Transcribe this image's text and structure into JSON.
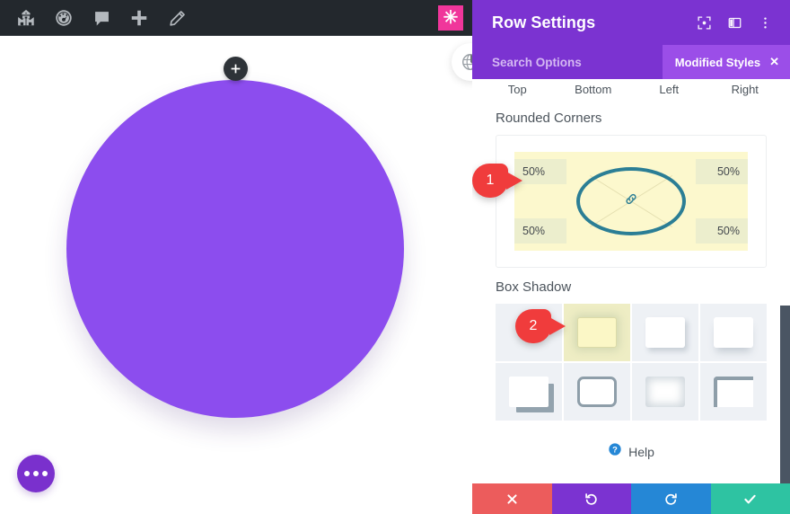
{
  "admin_bar": {
    "items": [
      {
        "name": "site-home-icon",
        "label": "My Sites"
      },
      {
        "name": "dashboard-icon",
        "label": "Dashboard"
      },
      {
        "name": "comments-icon",
        "label": "Comments"
      },
      {
        "name": "new-content-icon",
        "label": "New"
      },
      {
        "name": "edit-page-icon",
        "label": "Edit Page"
      }
    ],
    "badge": {
      "name": "divi-logo-icon",
      "glyph": "✳",
      "color": "#f0369b"
    },
    "background": "#23282d"
  },
  "canvas": {
    "module": {
      "shape": "circle",
      "color": "#8c4dee",
      "add_button_label": "+"
    },
    "globe_chip": {
      "name": "globe-icon"
    },
    "fab": {
      "name": "page-settings-fab",
      "dots": 3,
      "color": "#7a30cd"
    }
  },
  "panel": {
    "title": "Row Settings",
    "accent": "#7b33d1",
    "header_icons": [
      {
        "name": "expand-view-icon",
        "label": "Expand"
      },
      {
        "name": "panel-layout-icon",
        "label": "Layout"
      },
      {
        "name": "more-options-icon",
        "label": "More"
      }
    ],
    "search": {
      "placeholder": "Search Options",
      "value": ""
    },
    "modified_styles": {
      "label": "Modified Styles",
      "close_glyph": "✕",
      "color": "#9b4ee8"
    },
    "side_labels": [
      "Top",
      "Bottom",
      "Left",
      "Right"
    ],
    "rounded_corners": {
      "title": "Rounded Corners",
      "top_left": "50%",
      "top_right": "50%",
      "bottom_left": "50%",
      "bottom_right": "50%",
      "link_icon": "link-icon",
      "ring_color": "#2b7e95",
      "highlight_color": "#fcf8cd"
    },
    "box_shadow": {
      "title": "Box Shadow",
      "selected_index": 1,
      "presets": [
        {
          "name": "shadow-preset-none",
          "style": "s-none"
        },
        {
          "name": "shadow-preset-soft-glow",
          "style": "s-glow"
        },
        {
          "name": "shadow-preset-drop-right",
          "style": "s-soft"
        },
        {
          "name": "shadow-preset-drop-bottom",
          "style": "s-wide"
        },
        {
          "name": "shadow-preset-hard-offset",
          "style": "s-hard"
        },
        {
          "name": "shadow-preset-outline",
          "style": "s-border"
        },
        {
          "name": "shadow-preset-inset",
          "style": "s-inset"
        },
        {
          "name": "shadow-preset-corner-bracket",
          "style": "s-corner"
        }
      ]
    },
    "help": {
      "label": "Help",
      "icon": "help-circle-icon"
    },
    "actions": [
      {
        "name": "discard-button",
        "glyph": "✕",
        "color": "#ec5c5c"
      },
      {
        "name": "undo-button",
        "glyph": "↺",
        "color": "#7b33d1"
      },
      {
        "name": "redo-button",
        "glyph": "↻",
        "color": "#2587d6"
      },
      {
        "name": "save-button",
        "glyph": "✓",
        "color": "#2ec3a2"
      }
    ]
  },
  "callouts": [
    {
      "name": "callout-marker-1",
      "number": "1"
    },
    {
      "name": "callout-marker-2",
      "number": "2"
    }
  ]
}
